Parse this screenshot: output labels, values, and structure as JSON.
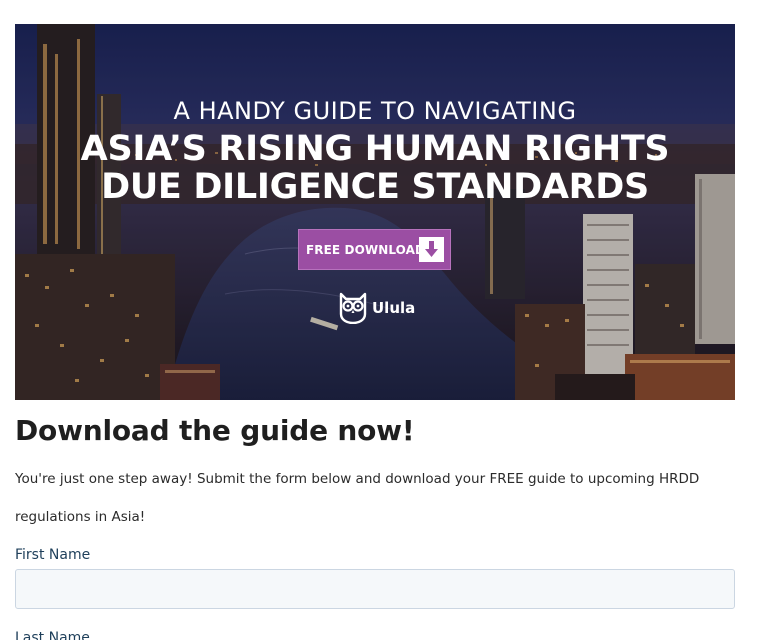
{
  "hero": {
    "kicker": "A HANDY GUIDE TO NAVIGATING",
    "title_line1": "ASIA’S RISING HUMAN RIGHTS",
    "title_line2": "DUE DILIGENCE STANDARDS",
    "button_label": "FREE DOWNLOAD",
    "button_icon": "arrow-down-icon",
    "brand_name": "Ulula",
    "brand_icon": "owl-logo-icon",
    "accent_color": "#9b4ea3"
  },
  "content": {
    "heading": "Download the guide now!",
    "intro": "You're just one step away! Submit the form below and download your FREE guide to upcoming HRDD regulations in Asia!"
  },
  "form": {
    "first_name_label": "First Name",
    "first_name_value": "",
    "last_name_label": "Last Name"
  }
}
